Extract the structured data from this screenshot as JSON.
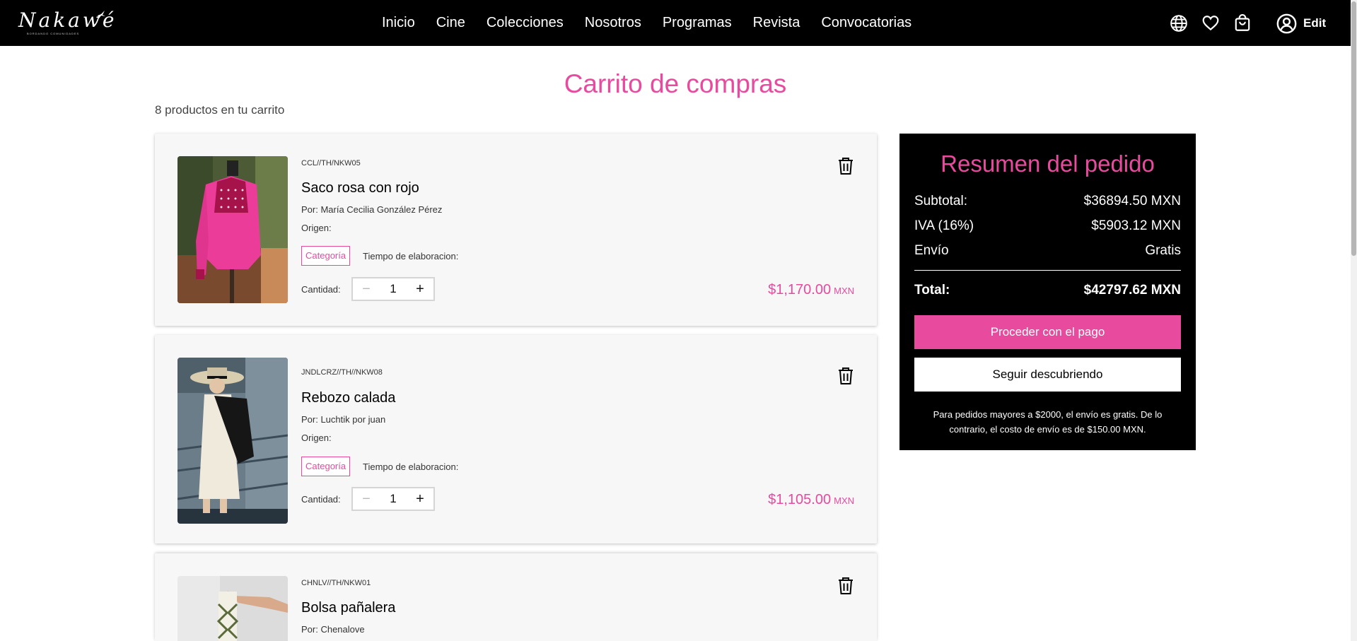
{
  "nav": {
    "logo_text": "Nakawé",
    "logo_tagline": "BORDANDO COMUNIDADES",
    "links": [
      "Inicio",
      "Cine",
      "Colecciones",
      "Nosotros",
      "Programas",
      "Revista",
      "Convocatorias"
    ],
    "icons": [
      "globe-icon",
      "heart-icon",
      "cart-icon"
    ],
    "user_label": "Edit"
  },
  "page": {
    "title": "Carrito de compras",
    "items_count": "8 productos en tu carrito"
  },
  "cart": {
    "items": [
      {
        "sku": "CCL//TH/NKW05",
        "name": "Saco rosa con rojo",
        "author": "Por: María Cecilia González Pérez",
        "origin": "Origen:",
        "category": "Categoría",
        "elaboration": "Tiempo de elaboracion:",
        "quantity_label": "Cantidad:",
        "quantity": "1",
        "price": "$1,170.00",
        "currency": "MXN"
      },
      {
        "sku": "JNDLCRZ//TH//NKW08",
        "name": "Rebozo calada",
        "author": "Por: Luchtik por juan",
        "origin": "Origen:",
        "category": "Categoría",
        "elaboration": "Tiempo de elaboracion:",
        "quantity_label": "Cantidad:",
        "quantity": "1",
        "price": "$1,105.00",
        "currency": "MXN"
      },
      {
        "sku": "CHNLV//TH/NKW01",
        "name": "Bolsa pañalera",
        "author": "Por: Chenalove"
      }
    ],
    "stepper_minus": "−",
    "stepper_plus": "+"
  },
  "summary": {
    "title": "Resumen del pedido",
    "subtotal_label": "Subtotal:",
    "subtotal_value": "$36894.50 MXN",
    "iva_label": "IVA (16%)",
    "iva_value": "$5903.12 MXN",
    "shipping_label": "Envío",
    "shipping_value": "Gratis",
    "total_label": "Total:",
    "total_value": "$42797.62 MXN",
    "pay_button": "Proceder con el pago",
    "continue_button": "Seguir descubriendo",
    "note": "Para pedidos mayores a $2000, el envío es gratis. De lo contrario, el costo de envío es de $150.00 MXN."
  },
  "colors": {
    "accent": "#e84a9d",
    "navbar": "#000000",
    "card_bg": "#f7f7f7"
  }
}
